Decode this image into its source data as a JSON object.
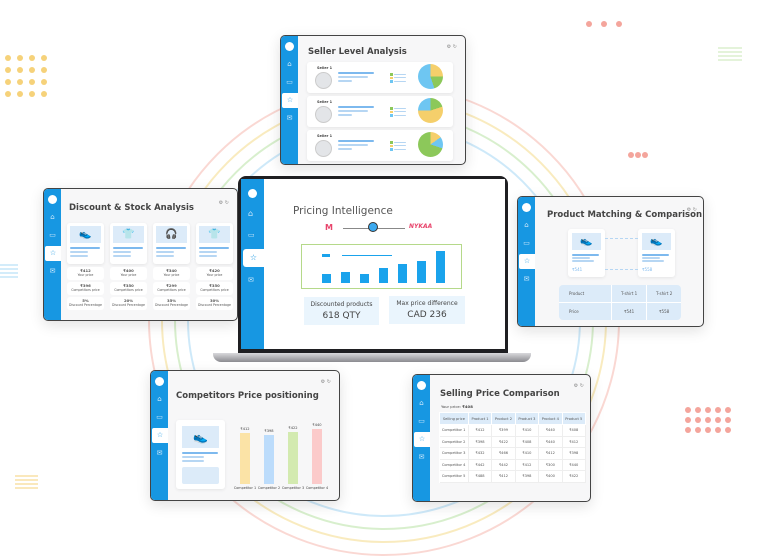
{
  "colors": {
    "accent": "#1797e2",
    "bars": "#1aa3ec",
    "arcs": [
      "#f7b9b0",
      "#f5dc8b",
      "#b9e3a6",
      "#a7d8f5"
    ]
  },
  "seller": {
    "title": "Seller Level Analysis",
    "rows": [
      {
        "name": "Seller 1"
      },
      {
        "name": "Seller 1"
      },
      {
        "name": "Seller 1"
      }
    ]
  },
  "discount": {
    "title": "Discount & Stock Analysis",
    "products": [
      {
        "icon": "shoe-icon",
        "your_price": "₹412",
        "your_label": "Your price",
        "comp_price": "₹396",
        "comp_label": "Competitors price",
        "discount": "5%",
        "discount_label": "Discount Percentage"
      },
      {
        "icon": "tshirt-icon",
        "your_price": "₹400",
        "your_label": "Your price",
        "comp_price": "₹350",
        "comp_label": "Competitors price",
        "discount": "20%",
        "discount_label": "Discount Percentage"
      },
      {
        "icon": "headphones-icon",
        "your_price": "₹340",
        "your_label": "Your price",
        "comp_price": "₹299",
        "comp_label": "Competitors price",
        "discount": "35%",
        "discount_label": "Discount Percentage"
      },
      {
        "icon": "tshirt-icon",
        "your_price": "₹420",
        "your_label": "Your price",
        "comp_price": "₹350",
        "comp_label": "Competitors price",
        "discount": "30%",
        "discount_label": "Discount Percentage"
      }
    ]
  },
  "main": {
    "title": "Pricing Intelligence",
    "brand_left": "Myntra",
    "brand_right": "NYKAA",
    "bar_levels": [
      0.25,
      0.3,
      0.25,
      0.42,
      0.52,
      0.62,
      0.9
    ],
    "stat1_label": "Discounted products",
    "stat1_value": "618 QTY",
    "stat2_label": "Max price difference",
    "stat2_value": "CAD 236"
  },
  "matching": {
    "title": "Product Matching & Comparison",
    "card1_price": "₹541",
    "card2_price": "₹558",
    "table": {
      "headers": [
        "Product",
        "T-shirt 1",
        "T-shirt 2"
      ],
      "row": [
        "Price",
        "₹541",
        "₹558"
      ]
    }
  },
  "competitors": {
    "title": "Competitors Price positioning",
    "bars": [
      {
        "label": "Competitor 1",
        "value": "₹412",
        "amount": 412,
        "color": "#fbe3a6"
      },
      {
        "label": "Competitor 2",
        "value": "₹398",
        "amount": 398,
        "color": "#bcdcfb"
      },
      {
        "label": "Competitor 3",
        "value": "₹422",
        "amount": 422,
        "color": "#d3eab0"
      },
      {
        "label": "Competitor 4",
        "value": "₹440",
        "amount": 440,
        "color": "#fbcaca"
      }
    ]
  },
  "selling": {
    "title": "Selling Price Comparison",
    "your_price_label": "Your price:",
    "your_price": "₹408",
    "headers": [
      "Selling price",
      "Product 1",
      "Product 2",
      "Product 3",
      "Product 4",
      "Product 5"
    ],
    "rows": [
      [
        "Competitor 1",
        "₹412",
        "₹399",
        "₹410",
        "₹440",
        "₹408"
      ],
      [
        "Competitor 2",
        "₹398",
        "₹422",
        "₹408",
        "₹440",
        "₹412"
      ],
      [
        "Competitor 3",
        "₹432",
        "₹466",
        "₹410",
        "₹412",
        "₹398"
      ],
      [
        "Competitor 4",
        "₹442",
        "₹442",
        "₹412",
        "₹300",
        "₹440"
      ],
      [
        "Competitor 5",
        "₹488",
        "₹412",
        "₹398",
        "₹400",
        "₹422"
      ]
    ]
  }
}
